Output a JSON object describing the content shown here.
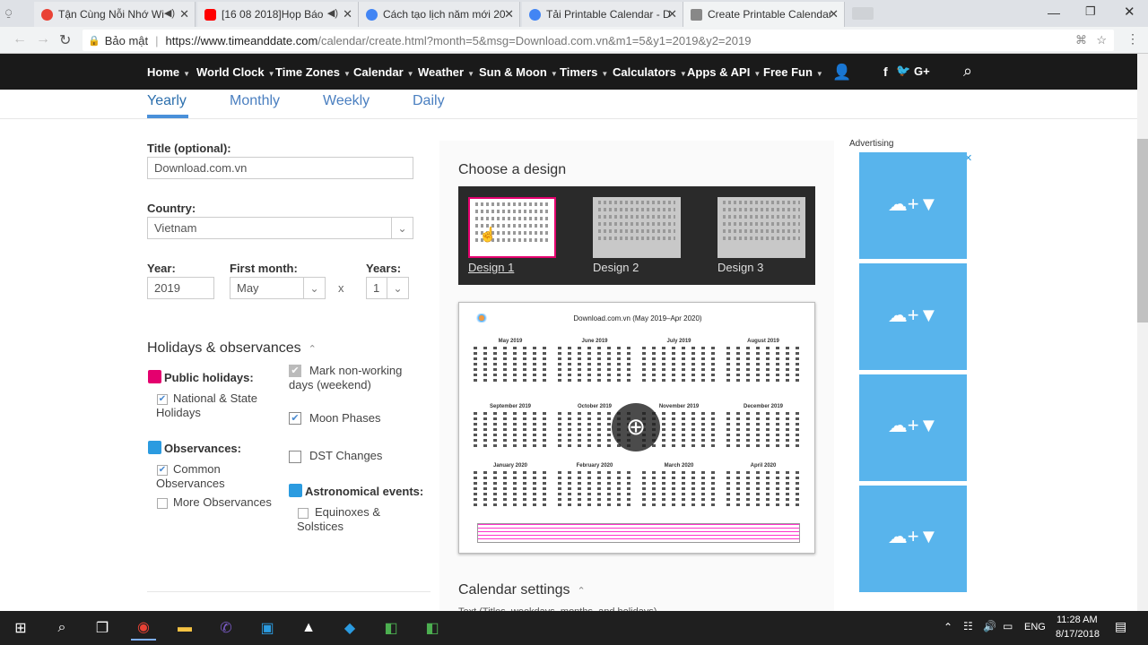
{
  "tabs": [
    {
      "title": "Tận Cùng Nỗi Nhớ Wi",
      "color": "#e94235"
    },
    {
      "title": "[16 08 2018]Họp Báo",
      "color": "#ff0000"
    },
    {
      "title": "Cách tạo lịch năm mới 20",
      "color": "#4285f4"
    },
    {
      "title": "Tải Printable Calendar - D",
      "color": "#4285f4"
    },
    {
      "title": "Create Printable Calendar",
      "color": "#666666"
    }
  ],
  "address": {
    "secure_label": "Bảo mật",
    "url_domain": "https://www.timeanddate.com",
    "url_path": "/calendar/create.html?month=5&msg=Download.com.vn&m1=5&y1=2019&y2=2019"
  },
  "nav": {
    "items": [
      "Home",
      "World Clock",
      "Time Zones",
      "Calendar",
      "Weather",
      "Sun & Moon",
      "Timers",
      "Calculators",
      "Apps & API",
      "Free Fun"
    ],
    "social": [
      "f",
      "🐦",
      "G+"
    ]
  },
  "page_tabs": [
    "Yearly",
    "Monthly",
    "Weekly",
    "Daily"
  ],
  "form": {
    "title_label": "Title (optional):",
    "title_value": "Download.com.vn",
    "country_label": "Country:",
    "country_value": "Vietnam",
    "year_label": "Year:",
    "year_value": "2019",
    "first_month_label": "First month:",
    "first_month_value": "May",
    "times": "x",
    "years_label": "Years:",
    "years_value": "1"
  },
  "holidays": {
    "heading": "Holidays & observances",
    "public_label": "Public holidays:",
    "national_state": "National & State Holidays",
    "observances_label": "Observances:",
    "common": "Common Observances",
    "more": "More Observances",
    "mark_nonworking": "Mark non-working days (weekend)",
    "moon": "Moon Phases",
    "dst": "DST Changes",
    "astro_label": "Astronomical events:",
    "equinoxes": "Equinoxes & Solstices",
    "public_color": "#e4006e",
    "obs_color": "#2b9be0"
  },
  "design": {
    "heading": "Choose a design",
    "options": [
      "Design 1",
      "Design 2",
      "Design 3"
    ]
  },
  "preview": {
    "title": "Download.com.vn (May 2019–Apr 2020)",
    "months": [
      "May 2019",
      "June 2019",
      "July 2019",
      "August 2019",
      "September 2019",
      "October 2019",
      "November 2019",
      "December 2019",
      "January 2020",
      "February 2020",
      "March 2020",
      "April 2020"
    ]
  },
  "settings_heading": "Calendar settings",
  "settings_sub": "Text (Titles, weekdays, months, and holidays)",
  "ad_label": "Advertising",
  "tray": {
    "lang": "ENG",
    "time": "11:28 AM",
    "date": "8/17/2018"
  }
}
